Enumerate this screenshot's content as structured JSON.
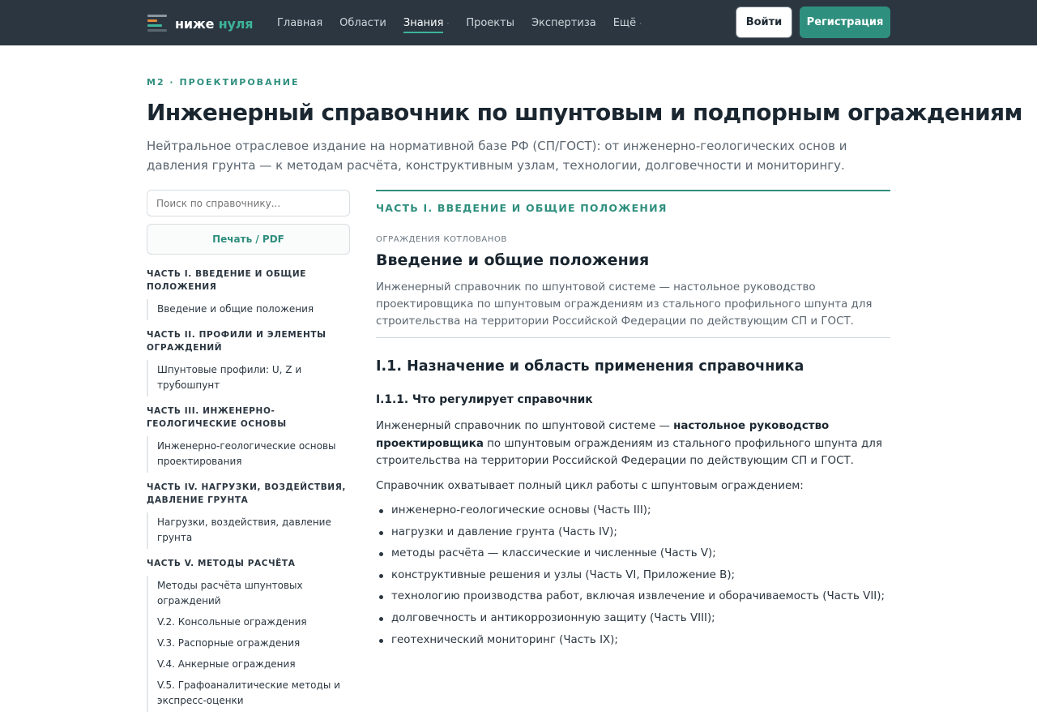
{
  "header": {
    "logo": {
      "word1": "ниже",
      "word2": "нуля"
    },
    "nav": [
      {
        "label": "Главная",
        "active": false,
        "dropdown": false
      },
      {
        "label": "Области",
        "active": false,
        "dropdown": false
      },
      {
        "label": "Знания",
        "active": true,
        "dropdown": true
      },
      {
        "label": "Проекты",
        "active": false,
        "dropdown": false
      },
      {
        "label": "Экспертиза",
        "active": false,
        "dropdown": false
      },
      {
        "label": "Ещё",
        "active": false,
        "dropdown": true
      }
    ],
    "nav_dropdown_glyph": "·",
    "login_label": "Войти",
    "register_label": "Регистрация"
  },
  "hero": {
    "crumb": "M2 · ПРОЕКТИРОВАНИЕ",
    "title": "Инженерный справочник по шпунтовым и подпорным ограждениям",
    "subtitle": "Нейтральное отраслевое издание на нормативной базе РФ (СП/ГОСТ): от инженерно-геологических основ и давления грунта — к методам расчёта, конструктивным узлам, технологии, долговечности и мониторингу."
  },
  "sidebar": {
    "search_placeholder": "Поиск по справочнику...",
    "print_label": "Печать / PDF",
    "toc": [
      {
        "part": "ЧАСТЬ I. ВВЕДЕНИЕ И ОБЩИЕ ПОЛОЖЕНИЯ",
        "links": [
          "Введение и общие положения"
        ]
      },
      {
        "part": "ЧАСТЬ II. ПРОФИЛИ И ЭЛЕМЕНТЫ ОГРАЖДЕНИЙ",
        "links": [
          "Шпунтовые профили: U, Z и трубошпунт"
        ]
      },
      {
        "part": "ЧАСТЬ III. ИНЖЕНЕРНО-ГЕОЛОГИЧЕСКИЕ ОСНОВЫ",
        "links": [
          "Инженерно-геологические основы проектирования"
        ]
      },
      {
        "part": "ЧАСТЬ IV. НАГРУЗКИ, ВОЗДЕЙСТВИЯ, ДАВЛЕНИЕ ГРУНТА",
        "links": [
          "Нагрузки, воздействия, давление грунта"
        ]
      },
      {
        "part": "ЧАСТЬ V. МЕТОДЫ РАСЧЁТА",
        "links": [
          "Методы расчёта шпунтовых ограждений",
          "V.2. Консольные ограждения",
          "V.3. Распорные ограждения",
          "V.4. Анкерные ограждения",
          "V.5. Графоаналитические методы и экспресс-оценки"
        ]
      }
    ]
  },
  "content": {
    "part_heading": "ЧАСТЬ I. ВВЕДЕНИЕ И ОБЩИЕ ПОЛОЖЕНИЯ",
    "kicker": "ОГРАЖДЕНИЯ КОТЛОВАНОВ",
    "section_title": "Введение и общие положения",
    "lead": "Инженерный справочник по шпунтовой системе — настольное руководство проектировщика по шпунтовым ограждениям из стального профильного шпунта для строительства на территории Российской Федерации по действующим СП и ГОСТ.",
    "h2": "I.1. Назначение и область применения справочника",
    "h3": "I.1.1. Что регулирует справочник",
    "para1_before": "Инженерный справочник по шпунтовой системе — ",
    "para1_bold": "настольное руководство проектировщика",
    "para1_after": " по шпунтовым ограждениям из стального профильного шпунта для строительства на территории Российской Федерации по действующим СП и ГОСТ.",
    "para2": "Справочник охватывает полный цикл работы с шпунтовым ограждением:",
    "bullets": [
      "инженерно-геологические основы (Часть III);",
      "нагрузки и давление грунта (Часть IV);",
      "методы расчёта — классические и численные (Часть V);",
      "конструктивные решения и узлы (Часть VI, Приложение В);",
      "технологию производства работ, включая извлечение и оборачиваемость (Часть VII);",
      "долговечность и антикоррозионную защиту (Часть VIII);",
      "геотехнический мониторинг (Часть IX);"
    ]
  },
  "colors": {
    "header_bg": "#2b3640",
    "accent": "#2f8f7e",
    "logo_accent": "#3db39a",
    "text": "#1e2a33",
    "muted": "#5b6670"
  }
}
